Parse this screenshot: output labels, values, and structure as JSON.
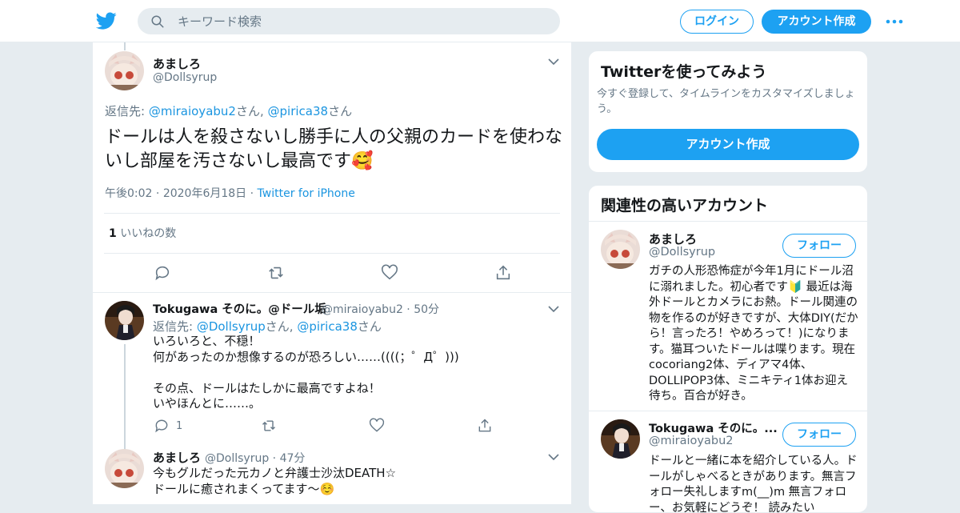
{
  "header": {
    "search_placeholder": "キーワード検索",
    "login_label": "ログイン",
    "signup_label": "アカウント作成"
  },
  "main_tweet": {
    "display_name": "あましろ",
    "handle": "@Dollsyrup",
    "reply_prefix": "返信先: ",
    "reply_user1": "@miraioyabu2",
    "reply_san1": "さん, ",
    "reply_user2": "@pirica38",
    "reply_san2": "さん",
    "text": "ドールは人を殺さないし勝手に人の父親のカードを使わないし部屋を汚さないし最高です🥰",
    "time": "午後0:02",
    "date": "2020年6月18日",
    "source": "Twitter for iPhone",
    "like_count": "1",
    "like_label": "いいねの数"
  },
  "replies": [
    {
      "display_name": "Tokugawa そのに。@ドール垢",
      "handle": "@miraioyabu2",
      "time": "50分",
      "reply_prefix": "返信先: ",
      "reply_user1": "@Dollsyrup",
      "reply_san1": "さん, ",
      "reply_user2": "@pirica38",
      "reply_san2": "さん",
      "text": "いろいろと、不穏！\n何があったのか想像するのが恐ろしい……((((；゜Д゜)))\n\nその点、ドールはたしかに最高ですよね！\nいやほんとに……。",
      "reply_count": "1"
    },
    {
      "display_name": "あましろ",
      "handle": "@Dollsyrup",
      "time": "47分",
      "text": "今もグルだった元カノと弁護士沙汰DEATH☆\nドールに癒されまくってます〜☺️"
    }
  ],
  "signup_card": {
    "title": "Twitterを使ってみよう",
    "description": "今すぐ登録して、タイムラインをカスタマイズしましょう。",
    "button": "アカウント作成"
  },
  "related_card": {
    "title": "関連性の高いアカウント",
    "accounts": [
      {
        "display_name": "あましろ",
        "handle": "@Dollsyrup",
        "follow_label": "フォロー",
        "bio": "ガチの人形恐怖症が今年1月にドール沼に溺れました。初心者です🔰 最近は海外ドールとカメラにお熱。ドール関連の物を作るのが好きですが、大体DIY(だから！言ったろ！やめろって！)になります。猫耳ついたドールは喋ります。現在cocoriang2体、ディアマ4体、DOLLIPOP3体、ミニキティ1体お迎え待ち。百合が好き。"
      },
      {
        "display_name": "Tokugawa そのに。...",
        "handle": "@miraioyabu2",
        "follow_label": "フォロー",
        "bio": "ドールと一緒に本を紹介している人。ドールがしゃべるときがあります。無言フォロー失礼しますm(__)m 無言フォロー、お気軽にどうぞ！ 読みたい"
      }
    ]
  },
  "colors": {
    "accent": "#1da1f2",
    "link": "#1b95e0",
    "muted": "#657786",
    "background": "#e6ecf0"
  },
  "icons": [
    "twitter-bird-icon",
    "search-icon",
    "more-dots-icon",
    "chevron-down-icon",
    "reply-icon",
    "retweet-icon",
    "like-icon",
    "share-icon"
  ]
}
